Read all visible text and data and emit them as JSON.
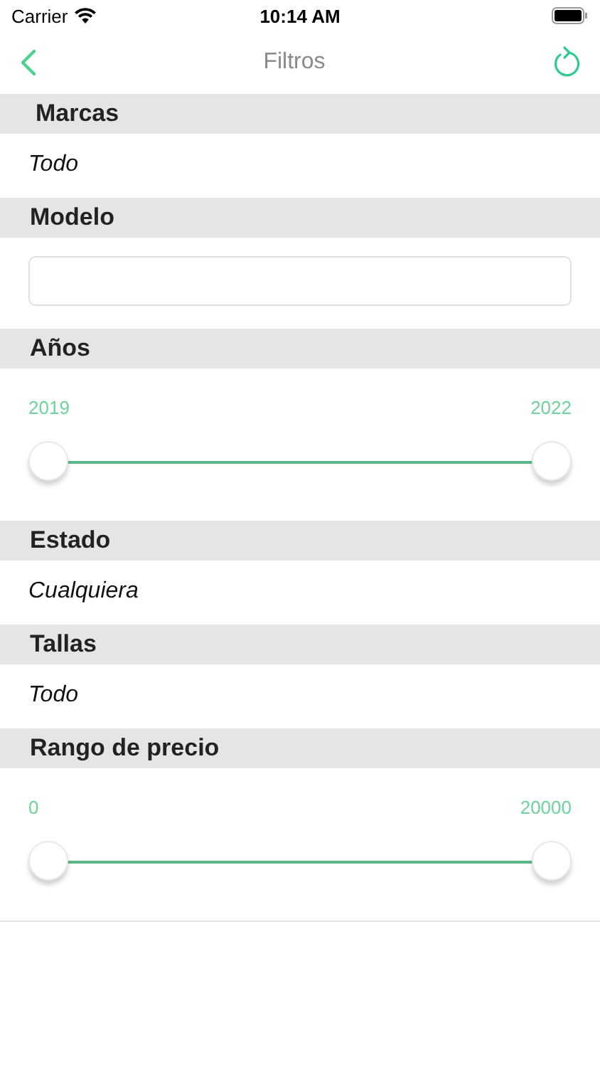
{
  "status_bar": {
    "carrier": "Carrier",
    "time": "10:14 AM"
  },
  "nav": {
    "title": "Filtros"
  },
  "sections": [
    {
      "kind": "value",
      "title": "Marcas",
      "value": "Todo"
    },
    {
      "kind": "field",
      "title": "Modelo"
    },
    {
      "kind": "range",
      "title": "Años",
      "min_label": "2019",
      "max_label": "2022",
      "level": 1
    },
    {
      "kind": "value",
      "title": "Estado",
      "value": "Cualquiera"
    },
    {
      "kind": "value",
      "title": "Tallas",
      "value": "Todo"
    },
    {
      "kind": "range",
      "title": "Rango de precio",
      "min_label": "0",
      "max_label": "20000",
      "level": 1
    }
  ]
}
